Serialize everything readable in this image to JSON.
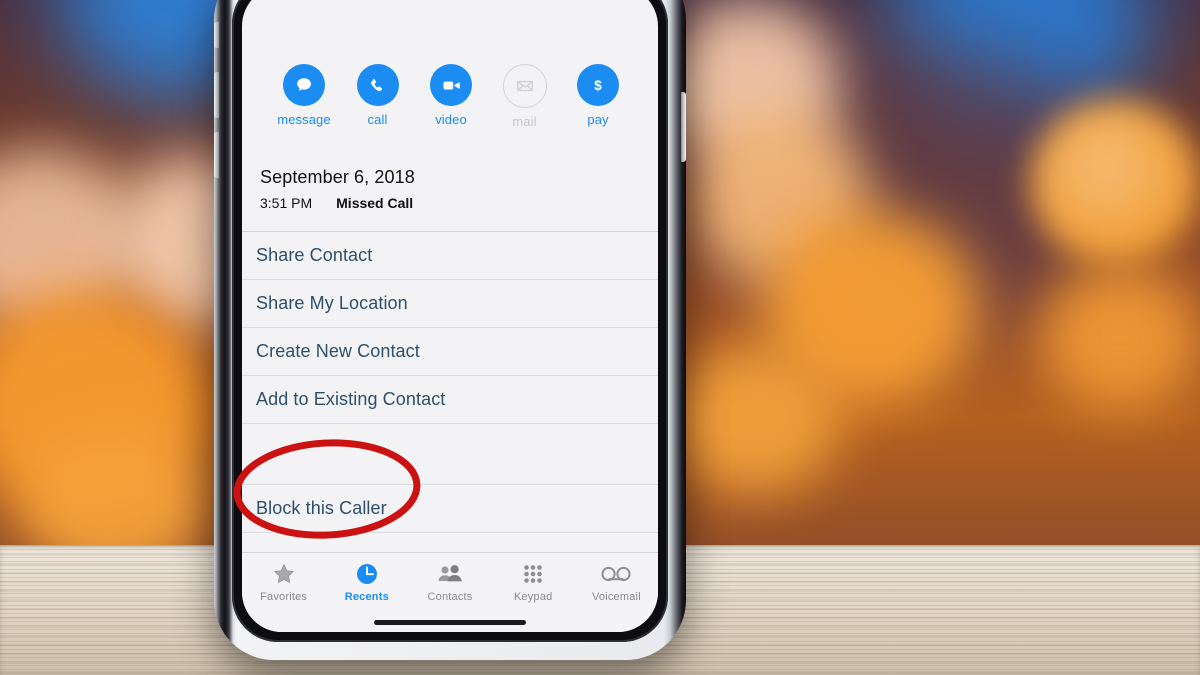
{
  "device": {
    "type": "smartphone",
    "orientation": "portrait",
    "buttons": [
      "silent-switch",
      "volume-up",
      "volume-down",
      "power"
    ]
  },
  "screen": {
    "app": "Phone",
    "view": "Recent call details",
    "quick_actions": [
      {
        "label": "message",
        "icon": "message-bubble-icon",
        "enabled": true
      },
      {
        "label": "call",
        "icon": "phone-handset-icon",
        "enabled": true
      },
      {
        "label": "video",
        "icon": "video-camera-icon",
        "enabled": true
      },
      {
        "label": "mail",
        "icon": "envelope-icon",
        "enabled": false
      },
      {
        "label": "pay",
        "icon": "dollar-sign-icon",
        "enabled": true
      }
    ],
    "call_entry": {
      "date": "September 6, 2018",
      "time": "3:51 PM",
      "status": "Missed Call"
    },
    "menu_items": [
      {
        "label": "Share Contact"
      },
      {
        "label": "Share My Location"
      },
      {
        "label": "Create New Contact"
      },
      {
        "label": "Add to Existing Contact"
      }
    ],
    "destructive_items": [
      {
        "label": "Block this Caller",
        "highlighted": true
      }
    ],
    "tabs": [
      {
        "label": "Favorites",
        "icon": "star-icon",
        "active": false
      },
      {
        "label": "Recents",
        "icon": "clock-icon",
        "active": true
      },
      {
        "label": "Contacts",
        "icon": "people-icon",
        "active": false
      },
      {
        "label": "Keypad",
        "icon": "keypad-dots-icon",
        "active": false
      },
      {
        "label": "Voicemail",
        "icon": "voicemail-reels-icon",
        "active": false
      }
    ]
  },
  "annotation": {
    "shape": "ellipse",
    "color": "#cc1111",
    "targets": "Block this Caller"
  },
  "colors": {
    "accent_blue": "#1a8cf2",
    "menu_text": "#2d4f6c",
    "screen_bg": "#f3f3f5",
    "annotation_red": "#cc1111",
    "inactive_gray": "#8a8a8e"
  },
  "background": {
    "scene": "blurred orange and blue bokeh lights above a light wooden surface"
  }
}
